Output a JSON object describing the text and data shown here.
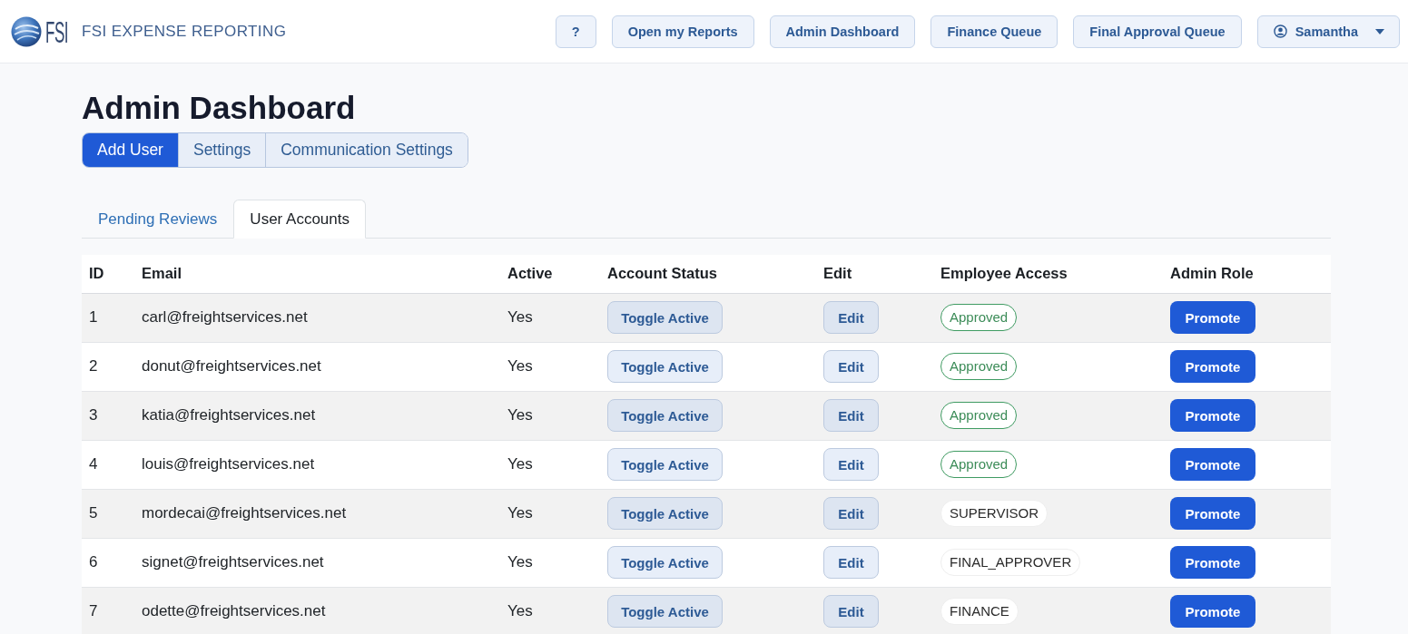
{
  "header": {
    "logo_mark": "FSI",
    "app_name": "FSI EXPENSE REPORTING",
    "nav": [
      {
        "label": "?",
        "kind": "button"
      },
      {
        "label": "Open my Reports",
        "kind": "button"
      },
      {
        "label": "Admin Dashboard",
        "kind": "button"
      },
      {
        "label": "Finance Queue",
        "kind": "button"
      },
      {
        "label": "Final Approval Queue",
        "kind": "button"
      },
      {
        "label": "Samantha",
        "kind": "user_menu"
      }
    ]
  },
  "page": {
    "title": "Admin Dashboard",
    "actions": [
      {
        "label": "Add User",
        "selected": true
      },
      {
        "label": "Settings",
        "selected": false
      },
      {
        "label": "Communication Settings",
        "selected": false
      }
    ],
    "tabs": [
      {
        "label": "Pending Reviews",
        "selected": false
      },
      {
        "label": "User Accounts",
        "selected": true
      }
    ],
    "table": {
      "columns": [
        "ID",
        "Email",
        "Active",
        "Account Status",
        "Edit",
        "Employee Access",
        "Admin Role"
      ],
      "rows": [
        {
          "id": "1",
          "email": "carl@freightservices.net",
          "active": "Yes",
          "status_button": "Toggle Active",
          "edit_button": "Edit",
          "access": {
            "label": "Approved",
            "kind": "approved"
          },
          "admin_button": "Promote"
        },
        {
          "id": "2",
          "email": "donut@freightservices.net",
          "active": "Yes",
          "status_button": "Toggle Active",
          "edit_button": "Edit",
          "access": {
            "label": "Approved",
            "kind": "approved"
          },
          "admin_button": "Promote"
        },
        {
          "id": "3",
          "email": "katia@freightservices.net",
          "active": "Yes",
          "status_button": "Toggle Active",
          "edit_button": "Edit",
          "access": {
            "label": "Approved",
            "kind": "approved"
          },
          "admin_button": "Promote"
        },
        {
          "id": "4",
          "email": "louis@freightservices.net",
          "active": "Yes",
          "status_button": "Toggle Active",
          "edit_button": "Edit",
          "access": {
            "label": "Approved",
            "kind": "approved"
          },
          "admin_button": "Promote"
        },
        {
          "id": "5",
          "email": "mordecai@freightservices.net",
          "active": "Yes",
          "status_button": "Toggle Active",
          "edit_button": "Edit",
          "access": {
            "label": "SUPERVISOR",
            "kind": "role"
          },
          "admin_button": "Promote"
        },
        {
          "id": "6",
          "email": "signet@freightservices.net",
          "active": "Yes",
          "status_button": "Toggle Active",
          "edit_button": "Edit",
          "access": {
            "label": "FINAL_APPROVER",
            "kind": "role"
          },
          "admin_button": "Promote"
        },
        {
          "id": "7",
          "email": "odette@freightservices.net",
          "active": "Yes",
          "status_button": "Toggle Active",
          "edit_button": "Edit",
          "access": {
            "label": "FINANCE",
            "kind": "role"
          },
          "admin_button": "Promote"
        }
      ]
    }
  }
}
